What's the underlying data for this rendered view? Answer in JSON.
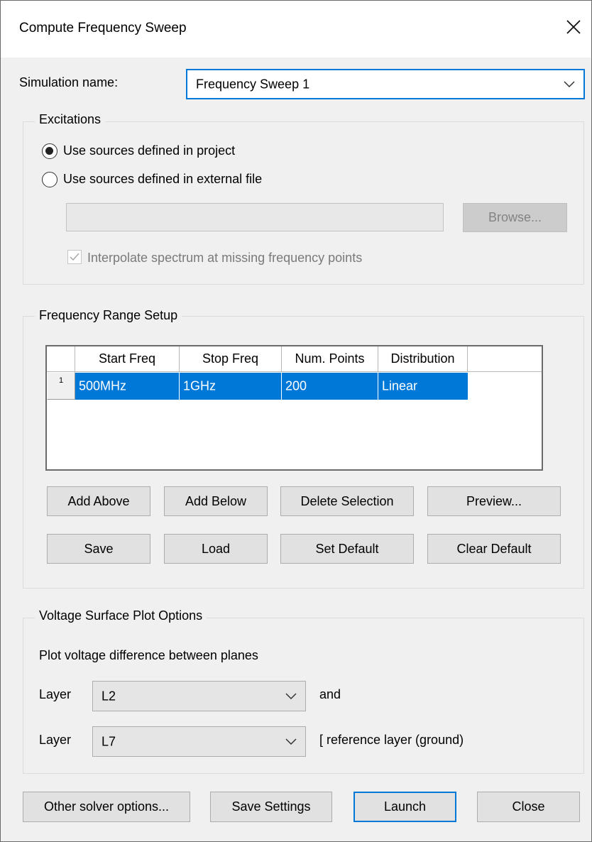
{
  "window": {
    "title": "Compute Frequency Sweep"
  },
  "simulation": {
    "label": "Simulation name:",
    "value": "Frequency Sweep 1"
  },
  "excitations": {
    "group_title": "Excitations",
    "option_project": "Use sources defined in project",
    "option_external": "Use sources defined in external file",
    "selected": "project",
    "file_path": "",
    "browse_label": "Browse...",
    "interpolate_label": "Interpolate spectrum at missing frequency points",
    "interpolate_checked": true
  },
  "frequency": {
    "group_title": "Frequency Range Setup",
    "columns": [
      "Start Freq",
      "Stop Freq",
      "Num. Points",
      "Distribution"
    ],
    "rows": [
      {
        "index": "1",
        "start": "500MHz",
        "stop": "1GHz",
        "points": "200",
        "distribution": "Linear"
      }
    ],
    "buttons": {
      "add_above": "Add Above",
      "add_below": "Add Below",
      "delete_selection": "Delete Selection",
      "preview": "Preview...",
      "save": "Save",
      "load": "Load",
      "set_default": "Set Default",
      "clear_default": "Clear Default"
    }
  },
  "voltage": {
    "group_title": "Voltage Surface Plot Options",
    "description": "Plot voltage difference between planes",
    "layer_label": "Layer",
    "layer1": "L2",
    "layer1_suffix": "and",
    "layer2": "L7",
    "layer2_suffix": "[ reference layer (ground)"
  },
  "footer": {
    "other_options": "Other solver options...",
    "save_settings": "Save Settings",
    "launch": "Launch",
    "close": "Close"
  },
  "colors": {
    "accent": "#0078d7",
    "selection": "#0078d7",
    "background": "#f0f0f0"
  }
}
